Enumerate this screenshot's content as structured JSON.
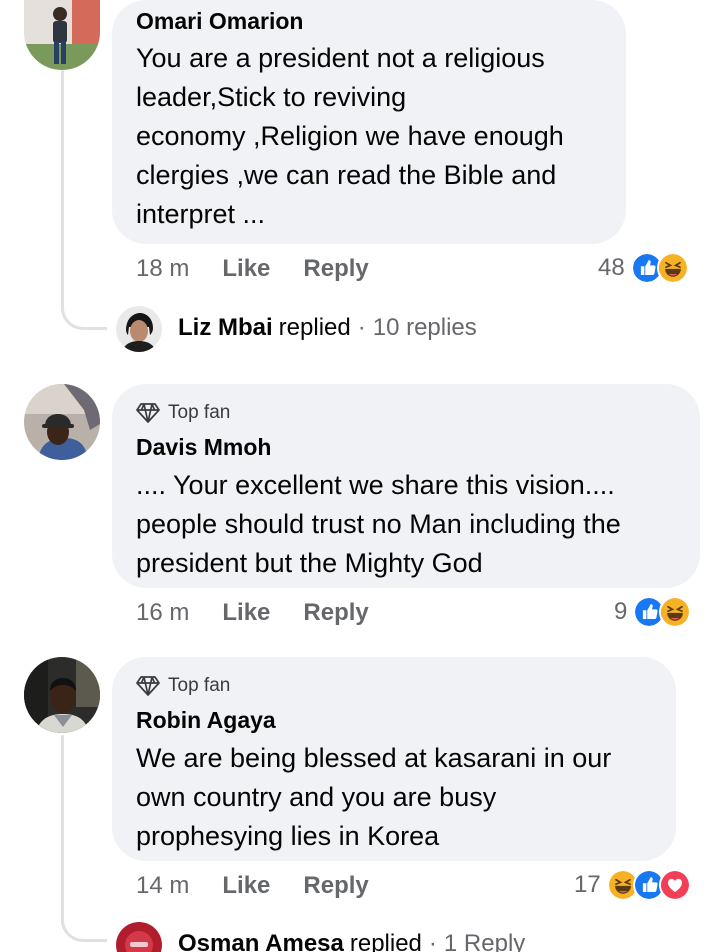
{
  "comments": [
    {
      "author": "Omari Omarion",
      "top_fan": "",
      "text": "You are a president not a religious\nleader,Stick to reviving\neconomy ,Religion we have enough\nclergies ,we  can read the Bible and\ninterpret ...",
      "time": "18 m",
      "like_label": "Like",
      "reply_label": "Reply",
      "reaction_count": "48",
      "reactions": [
        "like-icon",
        "haha-icon"
      ],
      "reply_summary": {
        "name": "Liz Mbai",
        "word": "replied",
        "dot": "·",
        "count": "10 replies"
      }
    },
    {
      "author": "Davis Mmoh",
      "top_fan": "Top fan",
      "text": ".... Your excellent we share this vision....\npeople should trust no Man including the\npresident  but the Mighty God",
      "time": "16 m",
      "like_label": "Like",
      "reply_label": "Reply",
      "reaction_count": "9",
      "reactions": [
        "like-icon",
        "haha-icon"
      ]
    },
    {
      "author": "Robin Agaya",
      "top_fan": "Top fan",
      "text": "We are being blessed at kasarani in our\nown country and you are busy\nprophesying lies in Korea",
      "time": "14 m",
      "like_label": "Like",
      "reply_label": "Reply",
      "reaction_count": "17",
      "reactions": [
        "haha-icon",
        "like-icon",
        "love-icon"
      ],
      "reply_summary": {
        "name": "Osman Amesa",
        "word": "replied",
        "dot": "·",
        "count": "1 Reply"
      }
    }
  ],
  "colors": {
    "bubble": "#f0f2f5",
    "meta_text": "#65676b",
    "like_blue": "#1877f2",
    "haha_yellow": "#f7b125",
    "love_red": "#f33e58"
  }
}
